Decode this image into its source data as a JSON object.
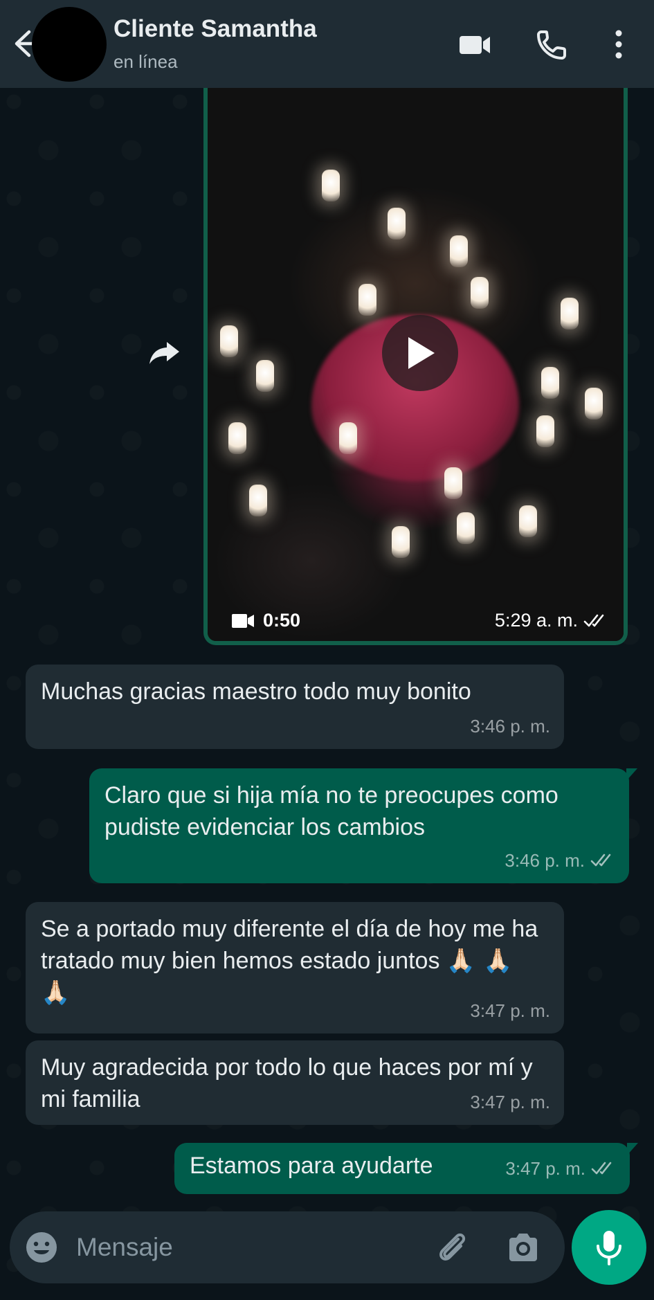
{
  "header": {
    "contact_name": "Cliente Samantha",
    "status": "en línea"
  },
  "icons": {
    "back": "arrow-left-icon",
    "video_call": "video-camera-icon",
    "voice_call": "phone-icon",
    "menu": "vertical-dots-icon",
    "forward": "forward-arrow-icon",
    "play": "play-icon",
    "emoji": "emoji-icon",
    "attach": "paperclip-icon",
    "camera": "camera-icon",
    "mic": "microphone-icon"
  },
  "video_message": {
    "duration": "0:50",
    "time": "5:29 a. m."
  },
  "messages": [
    {
      "direction": "in",
      "text": "Muchas gracias maestro todo muy bonito",
      "time": "3:46 p. m."
    },
    {
      "direction": "out",
      "text": "Claro que si hija mía no te preocupes como pudiste evidenciar los cambios",
      "time": "3:46 p. m.",
      "read": true
    },
    {
      "direction": "in",
      "text": "Se a portado muy diferente el día de hoy me ha tratado muy bien hemos estado juntos",
      "emoji": "🙏🏻 🙏🏻 🙏🏻",
      "time": "3:47 p. m."
    },
    {
      "direction": "in",
      "text": "Muy agradecida por todo lo que haces por mí y mi familia",
      "time": "3:47 p. m."
    },
    {
      "direction": "out",
      "text": "Estamos para ayudarte",
      "time": "3:47 p. m.",
      "read": true
    }
  ],
  "composer": {
    "placeholder": "Mensaje"
  },
  "colors": {
    "header_bg": "#1f2c34",
    "chat_bg": "#0b141a",
    "incoming_bubble": "#202c33",
    "outgoing_bubble": "#005c4b",
    "accent": "#00a884"
  }
}
